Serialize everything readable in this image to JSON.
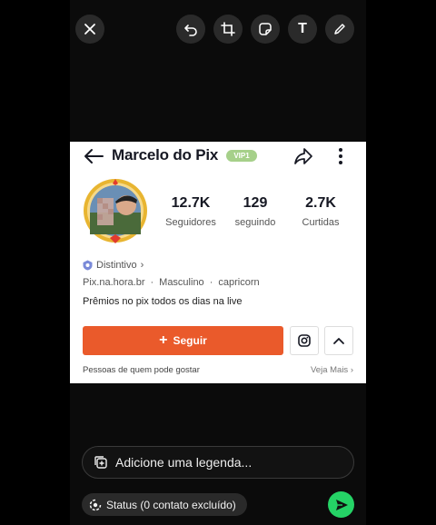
{
  "toolbar": {
    "icons": [
      "close-icon",
      "undo-icon",
      "crop-icon",
      "sticker-icon",
      "text-icon",
      "pen-icon"
    ],
    "text_label": "T"
  },
  "profile": {
    "name": "Marcelo do Pix",
    "vip": "VIP1",
    "stats": [
      {
        "value": "12.7K",
        "label": "Seguidores"
      },
      {
        "value": "129",
        "label": "seguindo"
      },
      {
        "value": "2.7K",
        "label": "Curtidas"
      }
    ],
    "badge": "Distintivo",
    "site": "Pix.na.hora.br",
    "gender": "Masculino",
    "sign": "capricorn",
    "bio": "Prêmios no pix todos os dias na live",
    "follow_label": "Seguir",
    "people_label": "Pessoas de quem pode gostar",
    "see_more": "Veja Mais"
  },
  "caption": {
    "placeholder": "Adicione uma legenda..."
  },
  "status": {
    "label": "Status (0 contato excluído)"
  },
  "colors": {
    "accent": "#ea5a2b",
    "send": "#25d366",
    "vip": "#a6d08a"
  }
}
